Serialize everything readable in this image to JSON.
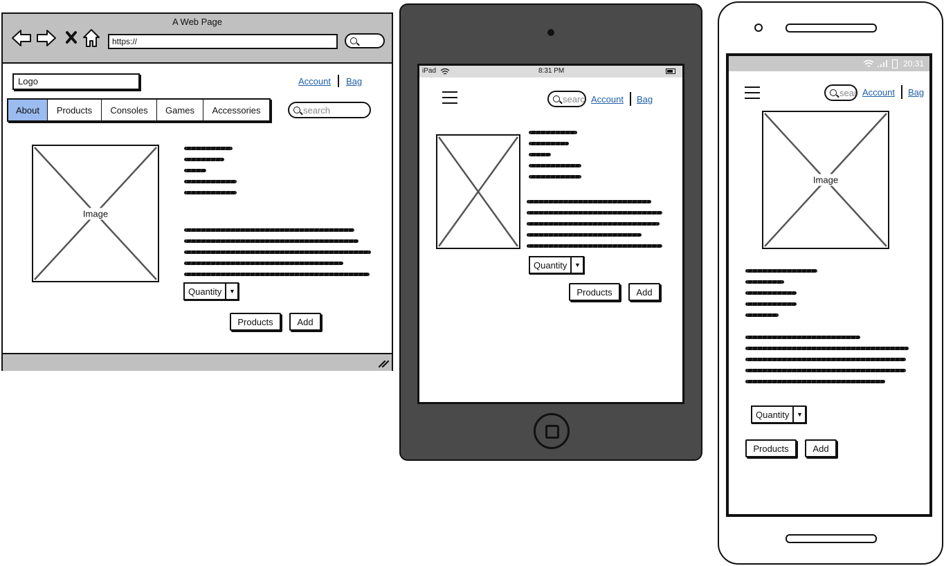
{
  "desktop": {
    "window_title": "A Web Page",
    "url": "https://",
    "logo": "Logo",
    "account": "Account",
    "bag": "Bag",
    "nav": [
      "About",
      "Products",
      "Consoles",
      "Games",
      "Accessories"
    ],
    "search_placeholder": "search",
    "image_label": "Image",
    "quantity": "Quantity",
    "products_btn": "Products",
    "add_btn": "Add"
  },
  "tablet": {
    "device": "iPad",
    "time": "8:31 PM",
    "search_placeholder": "search",
    "account": "Account",
    "bag": "Bag",
    "quantity": "Quantity",
    "products_btn": "Products",
    "add_btn": "Add"
  },
  "phone": {
    "time": "20:31",
    "search_placeholder": "search",
    "account": "Account",
    "bag": "Bag",
    "image_label": "Image",
    "quantity": "Quantity",
    "products_btn": "Products",
    "add_btn": "Add"
  },
  "colors": {
    "active_tab": "#9bbcf0",
    "chrome_gray": "#c0c0c0",
    "tablet_body": "#4a4a4a",
    "link": "#1f5fa8"
  }
}
